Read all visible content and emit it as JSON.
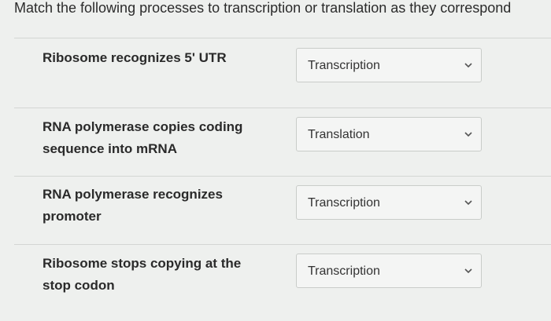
{
  "question": "Match the following processes to transcription or translation as they correspond",
  "rows": [
    {
      "label": "Ribosome recognizes 5' UTR",
      "selected": "Transcription"
    },
    {
      "label": "RNA polymerase copies coding sequence into mRNA",
      "selected": "Translation"
    },
    {
      "label": "RNA polymerase recognizes promoter",
      "selected": "Transcription"
    },
    {
      "label": "Ribosome stops copying at the stop codon",
      "selected": "Transcription"
    }
  ],
  "icons": {
    "dropdown": "chevron-down-icon"
  }
}
